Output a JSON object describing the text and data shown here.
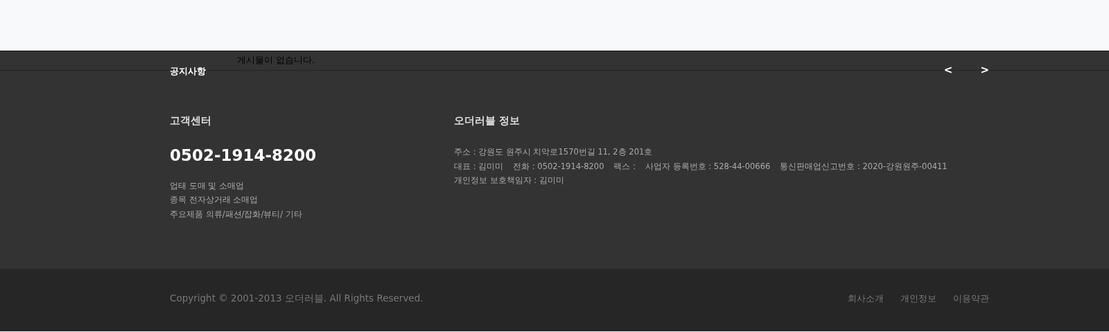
{
  "notice": {
    "title": "공지사항",
    "message": "게시물이 없습니다.",
    "prev_label": "<",
    "next_label": ">"
  },
  "customer_center": {
    "heading": "고객센터",
    "phone": "0502-1914-8200",
    "lines": [
      "업태 도매 및 소매업",
      "종목 전자상거래 소매업",
      "주요제품 의류/패션/잡화/뷰티/ 기타"
    ]
  },
  "company_info": {
    "heading": "오더러블 정보",
    "lines": [
      [
        "주소 : 강원도 원주시 치악로1570번길 11, 2층 201호"
      ],
      [
        "대표 : 김미미",
        "전화 : 0502-1914-8200",
        "팩스 :",
        "사업자 등록번호 : 528-44-00666",
        "통신판매업신고번호 : 2020-강원원주-00411"
      ],
      [
        "개인정보 보호책임자 : 김미미"
      ]
    ]
  },
  "bottom": {
    "copyright": "Copyright © 2001-2013 오더러블. All Rights Reserved.",
    "links": [
      "회사소개",
      "개인정보",
      "이용약관"
    ]
  }
}
